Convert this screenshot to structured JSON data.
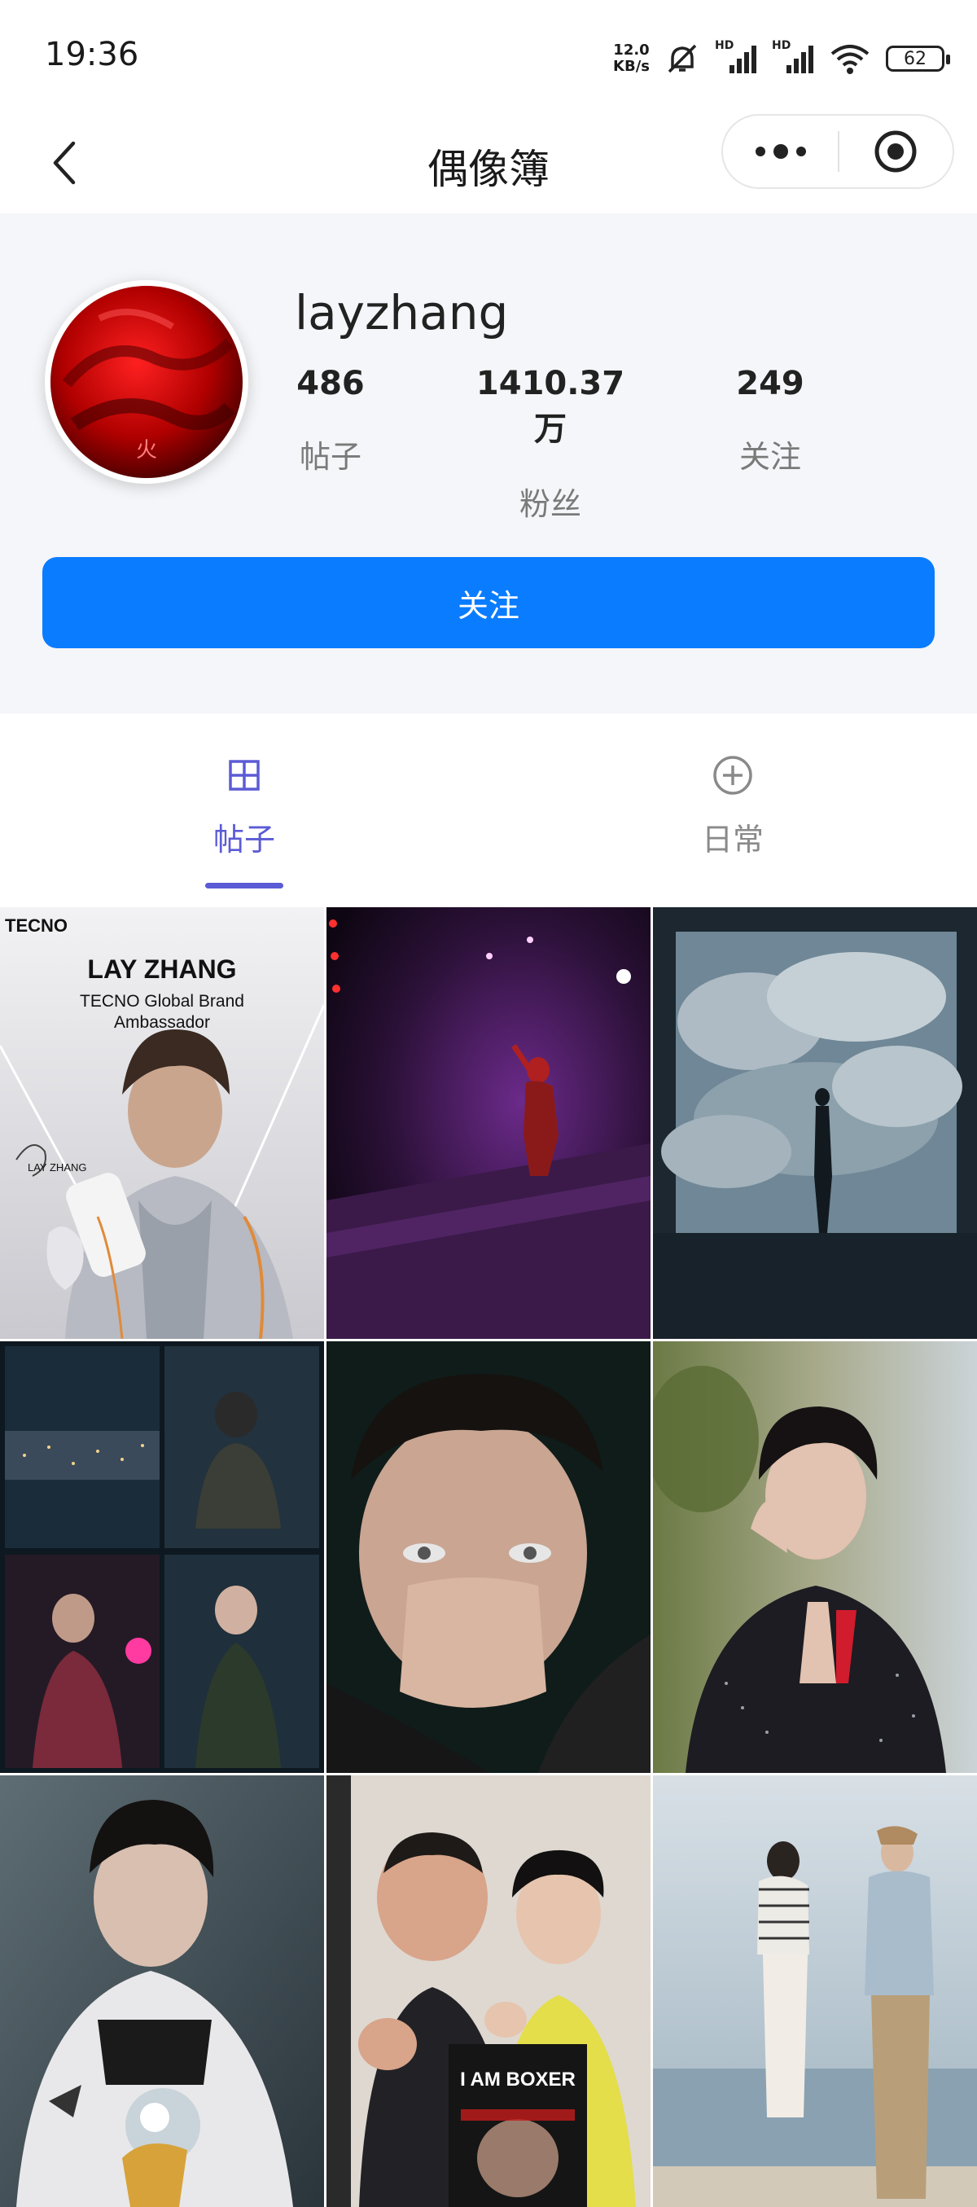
{
  "status_bar": {
    "time": "19:36",
    "net_speed_value": "12.0",
    "net_speed_unit": "KB/s",
    "signal_label": "HD",
    "battery": "62"
  },
  "nav": {
    "title": "偶像簿",
    "back_icon": "chevron-left-icon",
    "more_icon": "more-dots-icon",
    "close_icon": "target-close-icon"
  },
  "profile": {
    "username": "layzhang",
    "stats": [
      {
        "value": "486",
        "label": "帖子"
      },
      {
        "value": "1410.37万",
        "label": "粉丝"
      },
      {
        "value": "249",
        "label": "关注"
      }
    ],
    "follow_label": "关注"
  },
  "tabs": [
    {
      "label": "帖子",
      "icon": "grid-icon",
      "active": true
    },
    {
      "label": "日常",
      "icon": "plus-circle-icon",
      "active": false
    }
  ],
  "colors": {
    "accent": "#5b5bd6",
    "follow_button": "#0a7cff",
    "profile_bg": "#f5f6f9"
  },
  "posts": {
    "p1": {
      "brand": "TECNO",
      "title": "LAY ZHANG",
      "subtitle_1": "TECNO Global Brand",
      "subtitle_2": "Ambassador",
      "signature_name": "LAY ZHANG"
    },
    "p8": {
      "poster_title": "I AM BOXER"
    }
  }
}
